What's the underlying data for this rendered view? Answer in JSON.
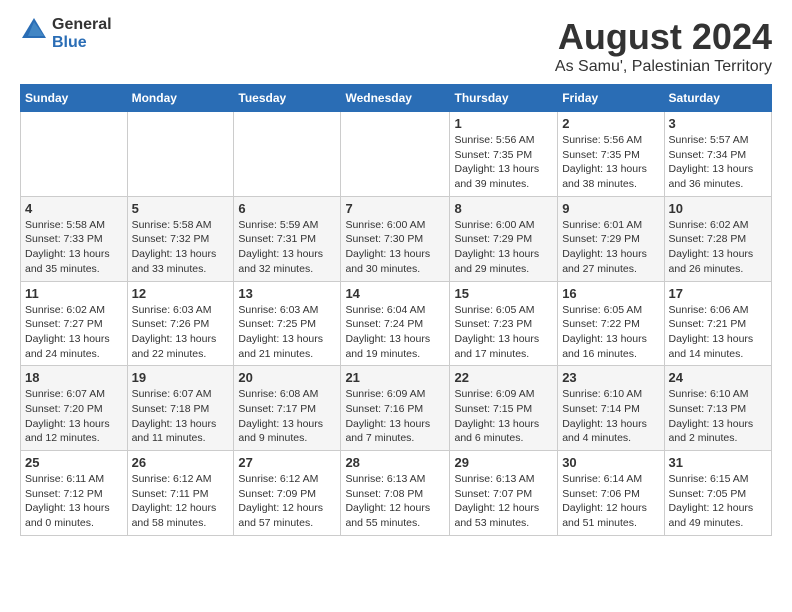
{
  "logo": {
    "general": "General",
    "blue": "Blue"
  },
  "title": "August 2024",
  "location": "As Samu', Palestinian Territory",
  "headers": [
    "Sunday",
    "Monday",
    "Tuesday",
    "Wednesday",
    "Thursday",
    "Friday",
    "Saturday"
  ],
  "weeks": [
    [
      {
        "day": "",
        "info": ""
      },
      {
        "day": "",
        "info": ""
      },
      {
        "day": "",
        "info": ""
      },
      {
        "day": "",
        "info": ""
      },
      {
        "day": "1",
        "info": "Sunrise: 5:56 AM\nSunset: 7:35 PM\nDaylight: 13 hours and 39 minutes."
      },
      {
        "day": "2",
        "info": "Sunrise: 5:56 AM\nSunset: 7:35 PM\nDaylight: 13 hours and 38 minutes."
      },
      {
        "day": "3",
        "info": "Sunrise: 5:57 AM\nSunset: 7:34 PM\nDaylight: 13 hours and 36 minutes."
      }
    ],
    [
      {
        "day": "4",
        "info": "Sunrise: 5:58 AM\nSunset: 7:33 PM\nDaylight: 13 hours and 35 minutes."
      },
      {
        "day": "5",
        "info": "Sunrise: 5:58 AM\nSunset: 7:32 PM\nDaylight: 13 hours and 33 minutes."
      },
      {
        "day": "6",
        "info": "Sunrise: 5:59 AM\nSunset: 7:31 PM\nDaylight: 13 hours and 32 minutes."
      },
      {
        "day": "7",
        "info": "Sunrise: 6:00 AM\nSunset: 7:30 PM\nDaylight: 13 hours and 30 minutes."
      },
      {
        "day": "8",
        "info": "Sunrise: 6:00 AM\nSunset: 7:29 PM\nDaylight: 13 hours and 29 minutes."
      },
      {
        "day": "9",
        "info": "Sunrise: 6:01 AM\nSunset: 7:29 PM\nDaylight: 13 hours and 27 minutes."
      },
      {
        "day": "10",
        "info": "Sunrise: 6:02 AM\nSunset: 7:28 PM\nDaylight: 13 hours and 26 minutes."
      }
    ],
    [
      {
        "day": "11",
        "info": "Sunrise: 6:02 AM\nSunset: 7:27 PM\nDaylight: 13 hours and 24 minutes."
      },
      {
        "day": "12",
        "info": "Sunrise: 6:03 AM\nSunset: 7:26 PM\nDaylight: 13 hours and 22 minutes."
      },
      {
        "day": "13",
        "info": "Sunrise: 6:03 AM\nSunset: 7:25 PM\nDaylight: 13 hours and 21 minutes."
      },
      {
        "day": "14",
        "info": "Sunrise: 6:04 AM\nSunset: 7:24 PM\nDaylight: 13 hours and 19 minutes."
      },
      {
        "day": "15",
        "info": "Sunrise: 6:05 AM\nSunset: 7:23 PM\nDaylight: 13 hours and 17 minutes."
      },
      {
        "day": "16",
        "info": "Sunrise: 6:05 AM\nSunset: 7:22 PM\nDaylight: 13 hours and 16 minutes."
      },
      {
        "day": "17",
        "info": "Sunrise: 6:06 AM\nSunset: 7:21 PM\nDaylight: 13 hours and 14 minutes."
      }
    ],
    [
      {
        "day": "18",
        "info": "Sunrise: 6:07 AM\nSunset: 7:20 PM\nDaylight: 13 hours and 12 minutes."
      },
      {
        "day": "19",
        "info": "Sunrise: 6:07 AM\nSunset: 7:18 PM\nDaylight: 13 hours and 11 minutes."
      },
      {
        "day": "20",
        "info": "Sunrise: 6:08 AM\nSunset: 7:17 PM\nDaylight: 13 hours and 9 minutes."
      },
      {
        "day": "21",
        "info": "Sunrise: 6:09 AM\nSunset: 7:16 PM\nDaylight: 13 hours and 7 minutes."
      },
      {
        "day": "22",
        "info": "Sunrise: 6:09 AM\nSunset: 7:15 PM\nDaylight: 13 hours and 6 minutes."
      },
      {
        "day": "23",
        "info": "Sunrise: 6:10 AM\nSunset: 7:14 PM\nDaylight: 13 hours and 4 minutes."
      },
      {
        "day": "24",
        "info": "Sunrise: 6:10 AM\nSunset: 7:13 PM\nDaylight: 13 hours and 2 minutes."
      }
    ],
    [
      {
        "day": "25",
        "info": "Sunrise: 6:11 AM\nSunset: 7:12 PM\nDaylight: 13 hours and 0 minutes."
      },
      {
        "day": "26",
        "info": "Sunrise: 6:12 AM\nSunset: 7:11 PM\nDaylight: 12 hours and 58 minutes."
      },
      {
        "day": "27",
        "info": "Sunrise: 6:12 AM\nSunset: 7:09 PM\nDaylight: 12 hours and 57 minutes."
      },
      {
        "day": "28",
        "info": "Sunrise: 6:13 AM\nSunset: 7:08 PM\nDaylight: 12 hours and 55 minutes."
      },
      {
        "day": "29",
        "info": "Sunrise: 6:13 AM\nSunset: 7:07 PM\nDaylight: 12 hours and 53 minutes."
      },
      {
        "day": "30",
        "info": "Sunrise: 6:14 AM\nSunset: 7:06 PM\nDaylight: 12 hours and 51 minutes."
      },
      {
        "day": "31",
        "info": "Sunrise: 6:15 AM\nSunset: 7:05 PM\nDaylight: 12 hours and 49 minutes."
      }
    ]
  ]
}
